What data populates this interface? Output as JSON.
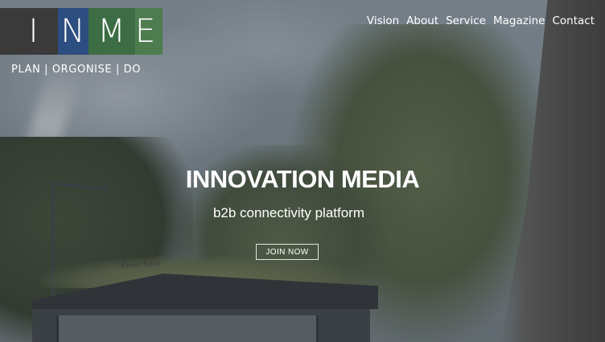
{
  "logo": {
    "letters_1": "I",
    "letters_2": "N",
    "letters_3": "M",
    "letters_4": "E"
  },
  "tagline": "PLAN | ORGONISE | DO",
  "nav": {
    "items": [
      {
        "label": "Vision"
      },
      {
        "label": "About"
      },
      {
        "label": "Service"
      },
      {
        "label": "Magazine"
      },
      {
        "label": "Contact"
      }
    ]
  },
  "hero": {
    "headline": "INNOVATION MEDIA",
    "subline": "b2b connectivity platform",
    "cta_label": "JOIN NOW",
    "sign_text": "Enter here"
  }
}
